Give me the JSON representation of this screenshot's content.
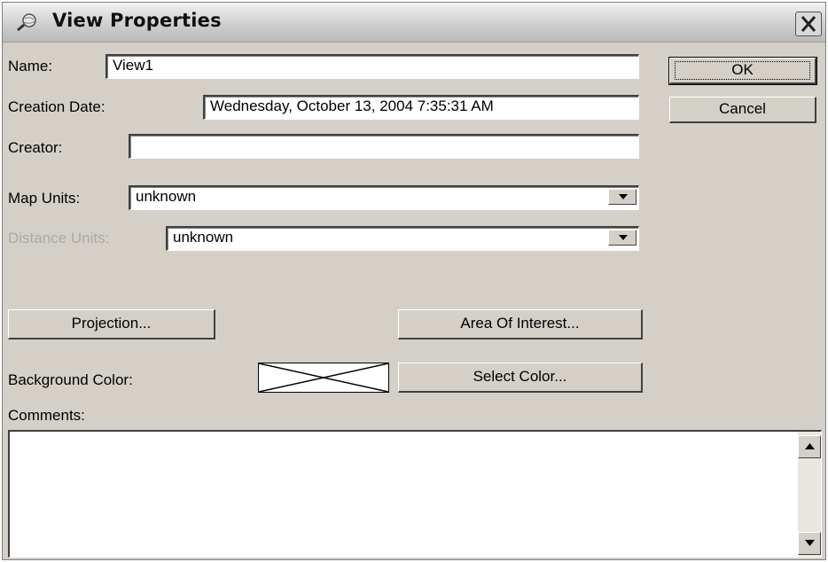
{
  "window": {
    "title": "View Properties",
    "title_icon": "magnifier-globe-icon",
    "close_icon": "close-icon"
  },
  "name": {
    "label": "Name:",
    "value": "View1"
  },
  "creation_date": {
    "label": "Creation Date:",
    "value": "Wednesday, October 13, 2004 7:35:31 AM"
  },
  "creator": {
    "label": "Creator:",
    "value": ""
  },
  "map_units": {
    "label": "Map Units:",
    "selected": "unknown"
  },
  "distance_units": {
    "label": "Distance Units:",
    "selected": "unknown",
    "enabled": false
  },
  "buttons": {
    "ok": "OK",
    "cancel": "Cancel",
    "projection": "Projection...",
    "area_of_interest": "Area Of Interest...",
    "select_color": "Select Color..."
  },
  "background_color": {
    "label": "Background Color:",
    "value": "none"
  },
  "comments": {
    "label": "Comments:",
    "value": ""
  }
}
